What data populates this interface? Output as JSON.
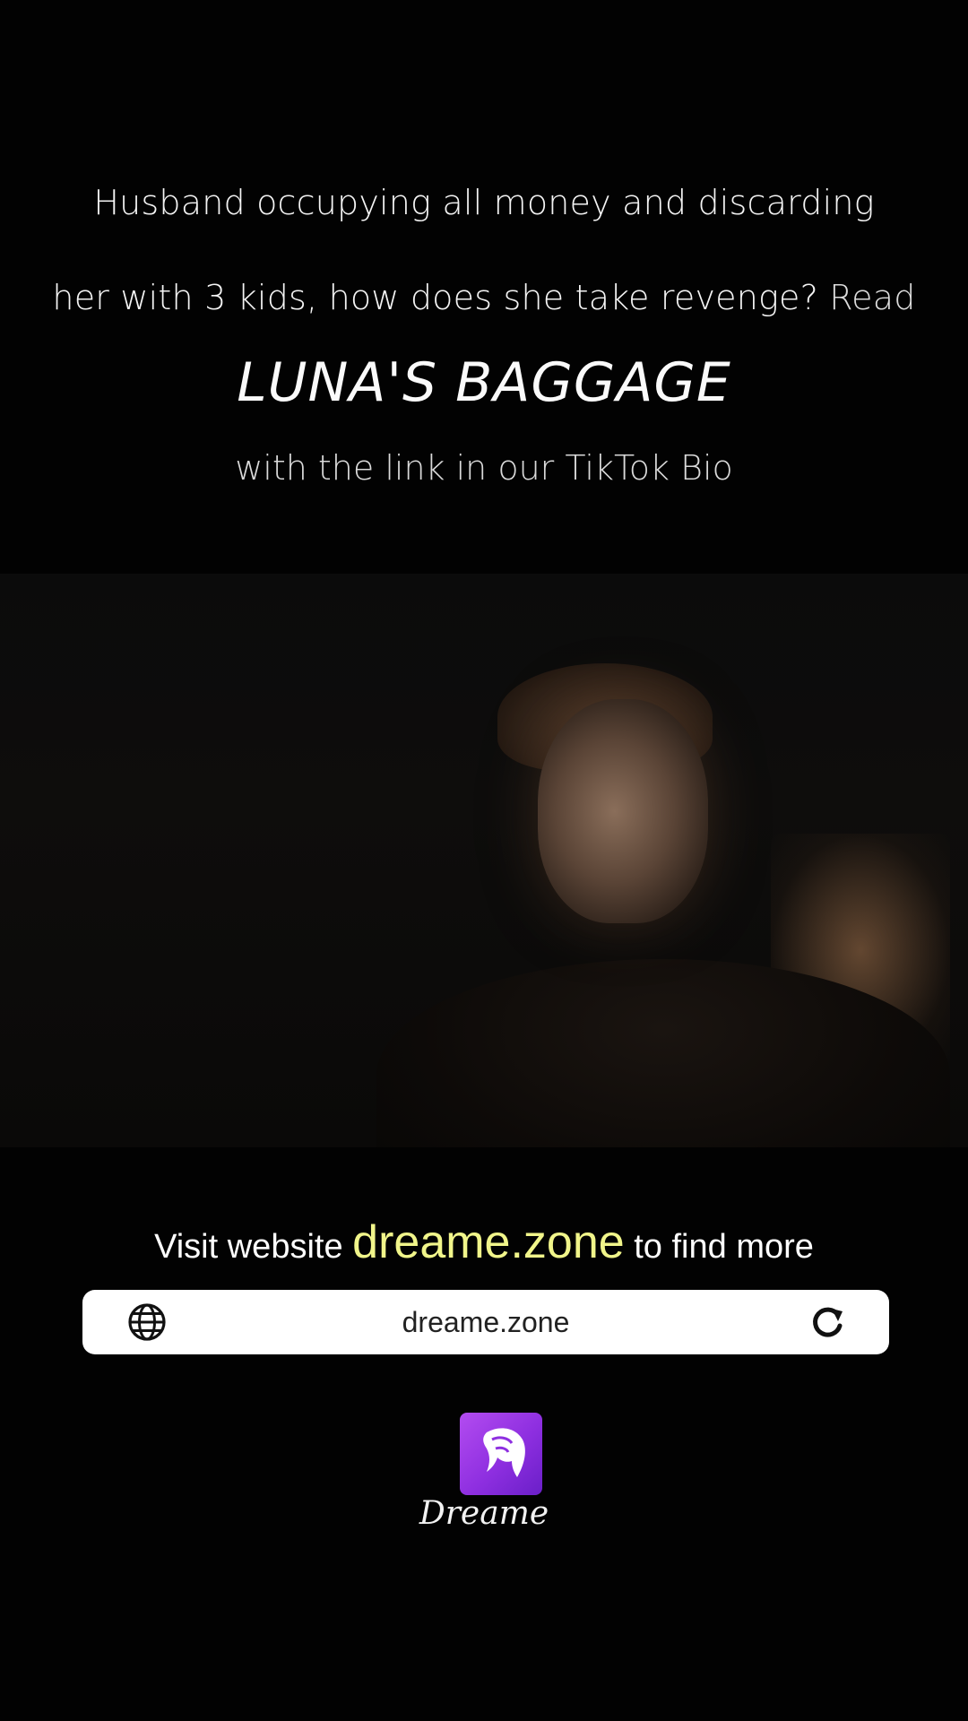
{
  "caption": {
    "line1": "Husband occupying all money and discarding",
    "line2_main": "her with 3 kids, how does she take revenge?",
    "line2_read": "Read",
    "book_title": "LUNA'S BAGGAGE",
    "line3": "with the link in our TikTok Bio"
  },
  "promo": {
    "prefix": "Visit website",
    "site": "dreame.zone",
    "suffix": "to find more",
    "url": "dreame.zone",
    "accent_color": "#f1f58a"
  },
  "logo": {
    "wordmark": "Dreame",
    "brand_color": "#9b3fe8",
    "icon": "horse-head-icon"
  },
  "icons": {
    "globe": "globe-icon",
    "reload": "reload-icon"
  }
}
